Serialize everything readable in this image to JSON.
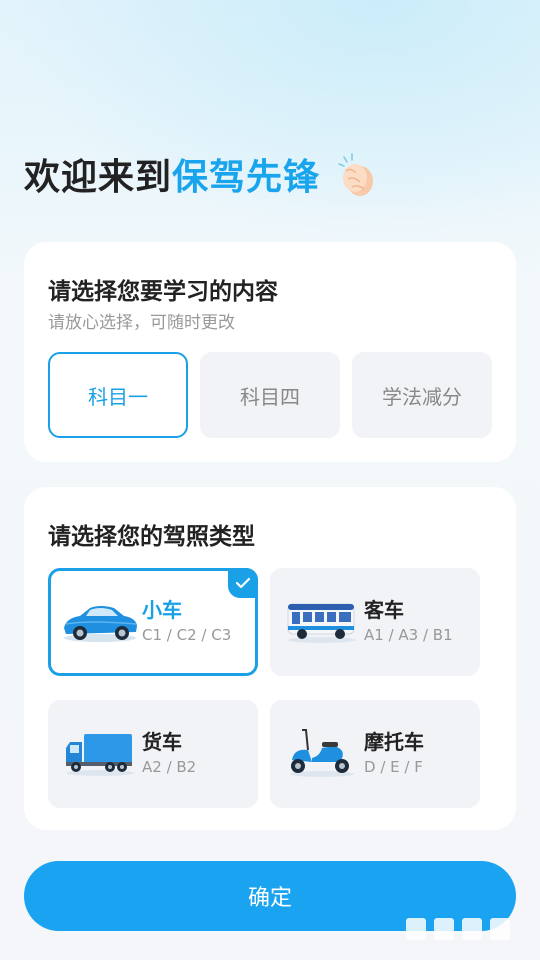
{
  "header": {
    "welcome_prefix": "欢迎来到",
    "brand_name": "保驾先锋",
    "clap_icon": "clapping-hands-icon"
  },
  "study_card": {
    "title": "请选择您要学习的内容",
    "subtitle": "请放心选择，可随时更改",
    "options": [
      {
        "label": "科目一",
        "selected": true
      },
      {
        "label": "科目四",
        "selected": false
      },
      {
        "label": "学法减分",
        "selected": false
      }
    ]
  },
  "license_card": {
    "title": "请选择您的驾照类型",
    "options": [
      {
        "name": "小车",
        "codes": "C1 / C2 / C3",
        "icon": "car-icon",
        "selected": true
      },
      {
        "name": "客车",
        "codes": "A1 / A3 / B1",
        "icon": "bus-icon",
        "selected": false
      },
      {
        "name": "货车",
        "codes": "A2 / B2",
        "icon": "truck-icon",
        "selected": false
      },
      {
        "name": "摩托车",
        "codes": "D / E / F",
        "icon": "scooter-icon",
        "selected": false
      }
    ]
  },
  "confirm_label": "确定",
  "colors": {
    "accent": "#1aa0e6",
    "button": "#1aa3f0",
    "title_text": "#222222",
    "muted_text": "#999999"
  }
}
